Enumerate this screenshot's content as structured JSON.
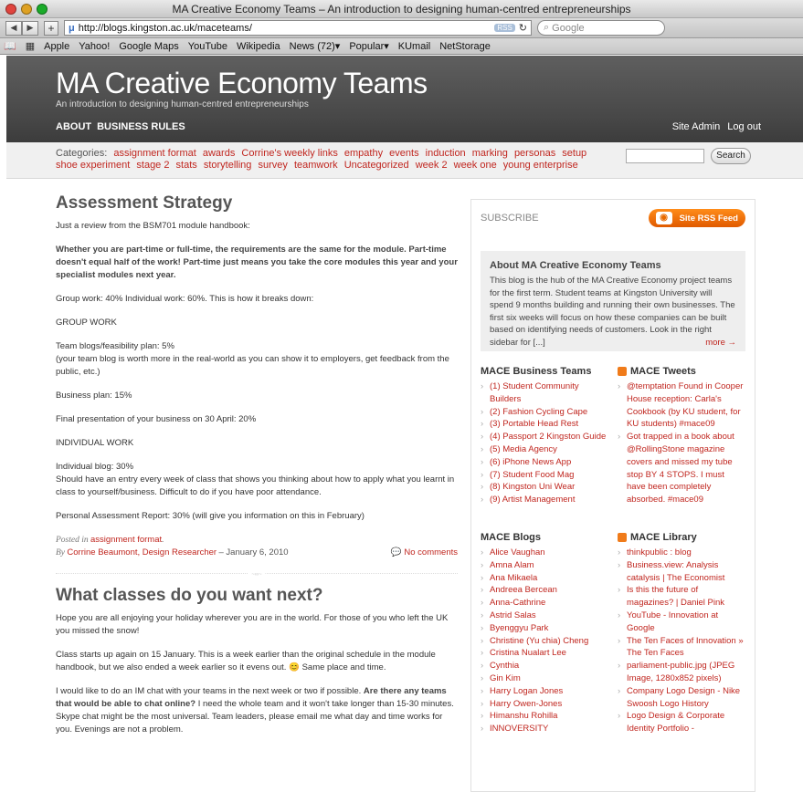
{
  "window": {
    "title": "MA Creative Economy Teams – An introduction to designing human-centred entrepreneurships"
  },
  "toolbar": {
    "url": "http://blogs.kingston.ac.uk/maceteams/",
    "rss": "RSS",
    "search_placeholder": "Google"
  },
  "bookmarks": [
    "Apple",
    "Yahoo!",
    "Google Maps",
    "YouTube",
    "Wikipedia",
    "News (72)▾",
    "Popular▾",
    "KUmail",
    "NetStorage"
  ],
  "site": {
    "title": "MA Creative Economy Teams",
    "tagline": "An introduction to designing human-centred entrepreneurships",
    "nav": [
      "ABOUT",
      "BUSINESS RULES"
    ],
    "admin": "Site Admin",
    "logout": "Log out"
  },
  "categories": {
    "label": "Categories:",
    "row1": [
      "assignment format",
      "awards",
      "Corrine's weekly links",
      "empathy",
      "events",
      "induction",
      "marking",
      "personas",
      "setup"
    ],
    "row2": [
      "shoe experiment",
      "stage 2",
      "stats",
      "storytelling",
      "survey",
      "teamwork",
      "Uncategorized",
      "week 2",
      "week one",
      "young enterprise"
    ],
    "search_button": "Search"
  },
  "post1": {
    "title": "Assessment Strategy",
    "p1": "Just a review from the BSM701 module handbook:",
    "p2": "Whether you are part-time or full-time, the requirements are the same for the module. Part-time doesn't equal half of the work! Part-time just means you take the core modules this year and your specialist modules next year.",
    "p3": "Group work: 40%  Individual work: 60%. This is how it breaks down:",
    "p4": "GROUP WORK",
    "p5a": "Team blogs/feasibility plan: 5%",
    "p5b": "(your team blog is worth more in the real-world as you can show it to employers, get feedback from the public, etc.)",
    "p6": "Business plan: 15%",
    "p7": "Final presentation of your business on 30 April: 20%",
    "p8": "INDIVIDUAL WORK",
    "p9a": "Individual blog: 30%",
    "p9b": "Should have an entry every week of class that shows you thinking about how to apply what you learnt in class to yourself/business. Difficult to do if you have poor attendance.",
    "p10": "Personal Assessment Report: 30% (will give you information on this in February)",
    "posted": "Posted in",
    "posted_cat": "assignment format",
    "by": "By",
    "author": "Corrine Beaumont, Design Researcher",
    "date": "– January 6, 2010",
    "comments": "No comments"
  },
  "post2": {
    "title": "What classes do you want next?",
    "p1": "Hope you are all enjoying your holiday wherever you are in the world. For those of you who left the UK you missed the snow!",
    "p2": "Class starts up again on 15 January. This is a week earlier than the original schedule in the module handbook, but we also ended a week earlier so it evens out.",
    "p2b": "Same place and time.",
    "p3a": "I would like to do an IM chat with your teams in the next week or two if possible.",
    "p3b": "Are there any teams that would be able to chat online?",
    "p3c": "I need the whole team and it won't take longer than 15-30 minutes. Skype chat might be the most universal. Team leaders, please email me what day and time works for you. Evenings are not a problem."
  },
  "sidebar": {
    "subscribe": "SUBSCRIBE",
    "feed_btn": "Site RSS Feed",
    "about_title": "About MA Creative Economy Teams",
    "about_text": "This blog is the hub of the MA Creative Economy project teams for the first term. Student teams at Kingston University will spend 9 months building and running their own businesses. The first six weeks will focus on how these companies can be built based on identifying needs of customers. Look in the right sidebar for [...]",
    "about_more": "more →",
    "teams_title": "MACE Business Teams",
    "teams": [
      "(1) Student Community Builders",
      "(2) Fashion Cycling Cape",
      "(3) Portable Head Rest",
      "(4) Passport 2 Kingston Guide",
      "(5) Media Agency",
      "(6) iPhone News App",
      "(7) Student Food Mag",
      "(8) Kingston Uni Wear",
      "(9) Artist Management"
    ],
    "tweets_title": "MACE Tweets",
    "tweets": [
      "@temptation Found in Cooper House reception: Carla's Cookbook (by KU student, for KU students) #mace09",
      "Got trapped in a book about @RollingStone magazine covers and missed my tube stop BY 4 STOPS. I must have been completely absorbed. #mace09"
    ],
    "blogs_title": "MACE Blogs",
    "blogs": [
      "Alice Vaughan",
      "Amna Alam",
      "Ana Mikaela",
      "Andreea Bercean",
      "Anna-Cathrine",
      "Astrid Salas",
      "Byenggyu Park",
      "Christine (Yu chia) Cheng",
      "Cristina Nualart Lee",
      "Cynthia",
      "Gin Kim",
      "Harry Logan Jones",
      "Harry Owen-Jones",
      "Himanshu Rohilla",
      "INNOVERSITY"
    ],
    "library_title": "MACE Library",
    "library": [
      "thinkpublic : blog",
      "Business.view: Analysis catalysis | The Economist",
      "Is this the future of magazines? | Daniel Pink",
      "YouTube - Innovation at Google",
      "The Ten Faces of Innovation » The Ten Faces",
      "parliament-public.jpg (JPEG Image, 1280x852 pixels)",
      "Company Logo Design - Nike Swoosh Logo History",
      "Logo Design & Corporate Identity Portfolio -"
    ]
  }
}
